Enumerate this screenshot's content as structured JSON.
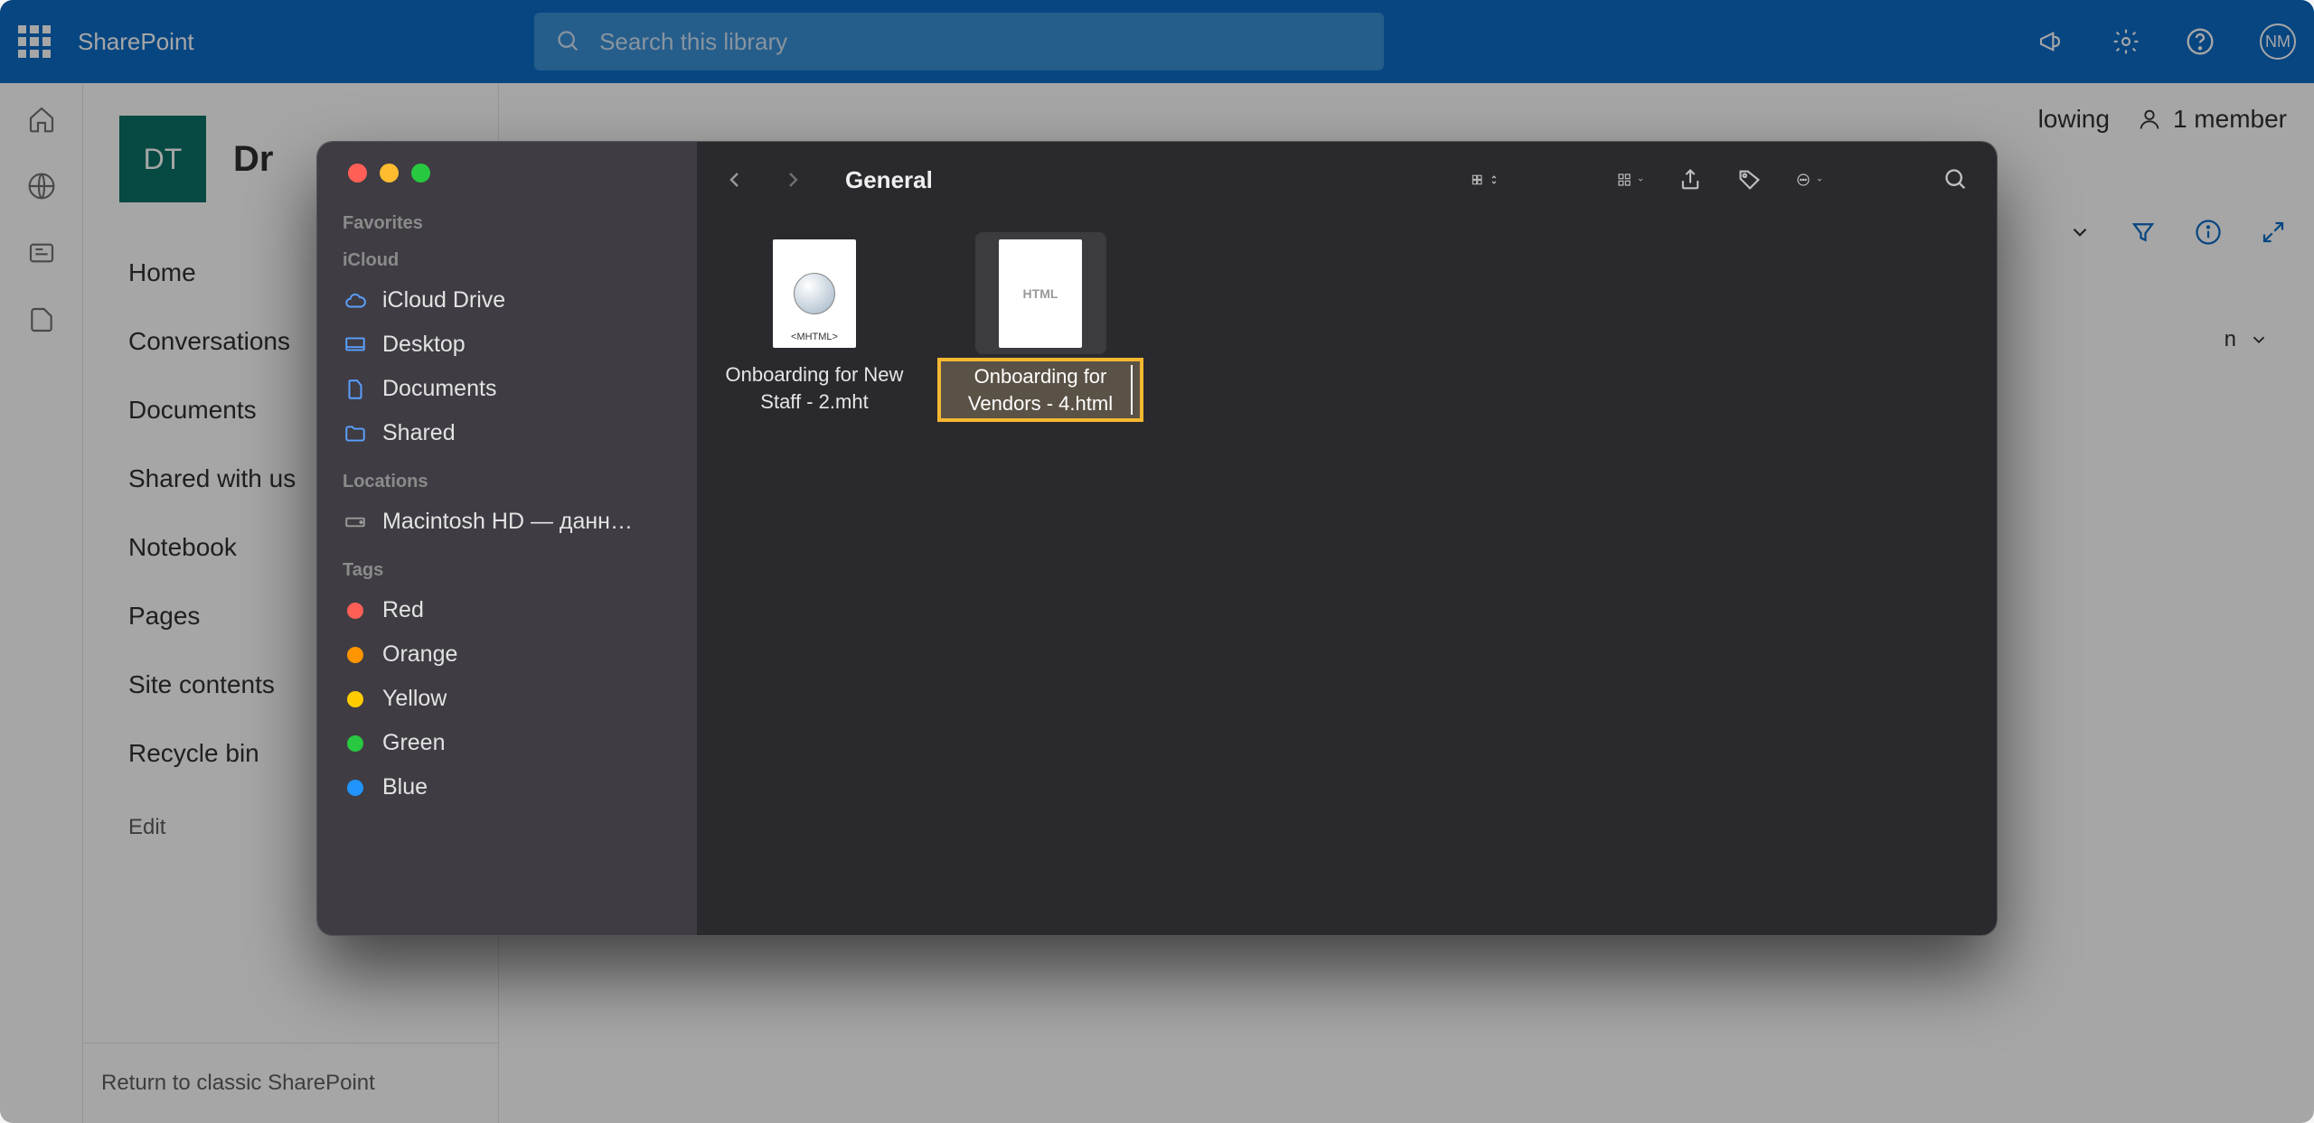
{
  "sharepoint": {
    "brand": "SharePoint",
    "search_placeholder": "Search this library",
    "avatar_initials": "NM",
    "site_initials": "DT",
    "site_name_partial": "Dr",
    "nav": [
      "Home",
      "Conversations",
      "Documents",
      "Shared with us",
      "Notebook",
      "Pages",
      "Site contents",
      "Recycle bin"
    ],
    "edit": "Edit",
    "classic": "Return to classic SharePoint",
    "following_partial": "lowing",
    "members": "1 member",
    "column_partial": "n"
  },
  "finder": {
    "title": "General",
    "sidebar": {
      "favorites": "Favorites",
      "icloud_header": "iCloud",
      "icloud_items": [
        "iCloud Drive",
        "Desktop",
        "Documents",
        "Shared"
      ],
      "locations_header": "Locations",
      "locations": [
        "Macintosh HD — данн…"
      ],
      "tags_header": "Tags",
      "tags": [
        {
          "label": "Red",
          "color": "#ff5f57"
        },
        {
          "label": "Orange",
          "color": "#ff9500"
        },
        {
          "label": "Yellow",
          "color": "#ffcc00"
        },
        {
          "label": "Green",
          "color": "#28c840"
        },
        {
          "label": "Blue",
          "color": "#2094fa"
        }
      ]
    },
    "files": [
      {
        "name": "Onboarding for New Staff - 2.mht",
        "type": "mht",
        "selected": false,
        "editing": false
      },
      {
        "name": "Onboarding for Vendors - 4.html",
        "type": "html",
        "selected": true,
        "editing": true
      }
    ],
    "html_badge": "HTML"
  }
}
